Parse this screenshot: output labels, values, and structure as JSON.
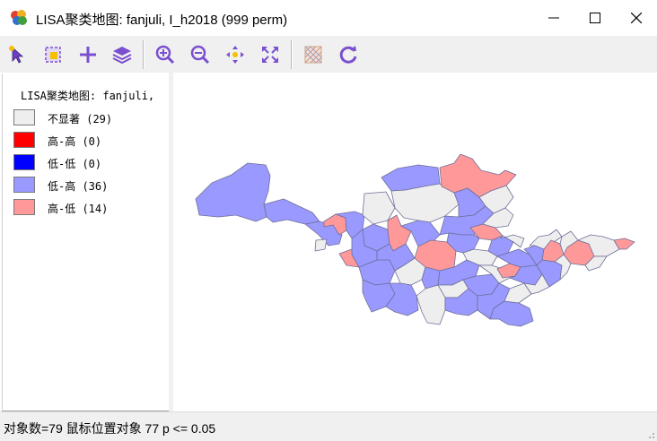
{
  "window": {
    "title": "LISA聚类地图: fanjuli, I_h2018 (999 perm)",
    "controls": [
      "minimize",
      "maximize",
      "close"
    ]
  },
  "toolbar": {
    "tools": [
      "select-arrow-icon",
      "selection-tool-icon",
      "add-layer-icon",
      "layers-icon",
      "zoom-in-icon",
      "zoom-out-icon",
      "pan-icon",
      "full-extent-icon",
      "basemap-icon",
      "refresh-icon"
    ],
    "accent_color": "#7a4fd0"
  },
  "legend": {
    "title": "LISA聚类地图: fanjuli,",
    "items": [
      {
        "label": "不显著 (29)",
        "color": "#eeeeee"
      },
      {
        "label": "高-高 (0)",
        "color": "#ff0000"
      },
      {
        "label": "低-低 (0)",
        "color": "#0000ff"
      },
      {
        "label": "低-高 (36)",
        "color": "#9999ff"
      },
      {
        "label": "高-低 (14)",
        "color": "#ff9999"
      }
    ]
  },
  "map": {
    "colors": {
      "not_significant": "#eeeeee",
      "low_high": "#9999ff",
      "high_low": "#ff9999",
      "outline": "#6f6f9a"
    }
  },
  "status": {
    "text": "对象数=79 鼠标位置对象 77 p <= 0.05"
  }
}
